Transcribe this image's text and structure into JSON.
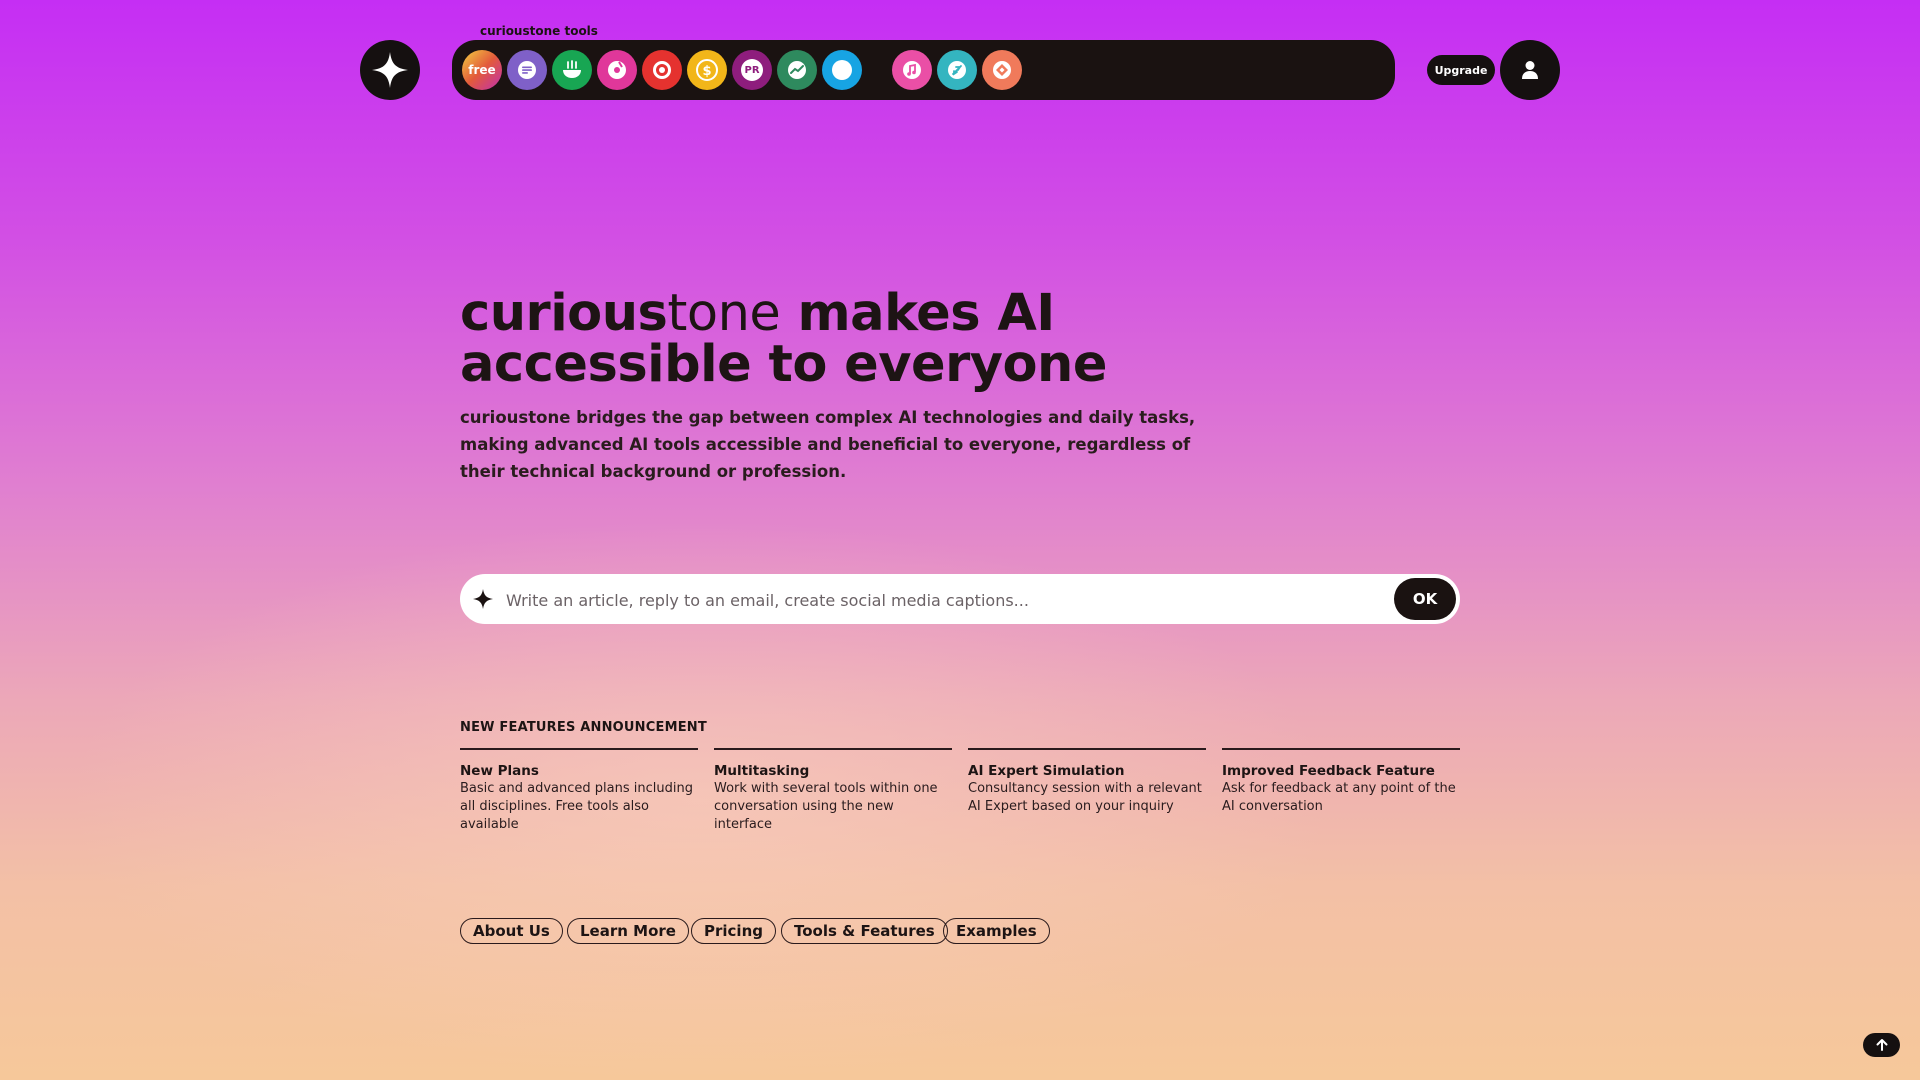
{
  "header": {
    "tools_label": "curioustone tools",
    "free_badge": "free",
    "pr_badge": "PR",
    "upgrade_label": "Upgrade",
    "tools": [
      {
        "name": "free-tool",
        "color": "#e8a33a"
      },
      {
        "name": "text-tool",
        "color": "#7f60c8"
      },
      {
        "name": "food-tool",
        "color": "#18a653"
      },
      {
        "name": "music-tool",
        "color": "#e0379a"
      },
      {
        "name": "target-tool",
        "color": "#e5322f"
      },
      {
        "name": "money-tool",
        "color": "#f2b619"
      },
      {
        "name": "pr-tool",
        "color": "#8e1d7d"
      },
      {
        "name": "chart-tool",
        "color": "#2e8a5e"
      },
      {
        "name": "circle-tool",
        "color": "#17a4e3"
      },
      {
        "name": "note-tool",
        "color": "#ea4fa6"
      },
      {
        "name": "travel-tool",
        "color": "#34b5c0"
      },
      {
        "name": "diamond-tool",
        "color": "#f07a5b"
      }
    ]
  },
  "hero": {
    "brand_bold": "curious",
    "brand_light": "tone",
    "headline_rest": " makes AI accessible to everyone",
    "description": "curioustone bridges the gap between complex AI technologies and daily tasks, making advanced AI tools accessible and beneficial to everyone, regardless of their technical background or profession."
  },
  "prompt": {
    "placeholder": "Write an article, reply to an email, create social media captions...",
    "ok_label": "OK"
  },
  "features": {
    "title": "NEW FEATURES ANNOUNCEMENT",
    "items": [
      {
        "title": "New Plans",
        "desc": "Basic and advanced plans including all disciplines. Free tools also available"
      },
      {
        "title": "Multitasking",
        "desc": "Work with several tools within one conversation using the new interface"
      },
      {
        "title": "AI Expert Simulation",
        "desc": "Consultancy session with a relevant AI Expert based on your inquiry"
      },
      {
        "title": "Improved Feedback Feature",
        "desc": "Ask for feedback at any point of the AI conversation"
      }
    ]
  },
  "links": [
    "About Us",
    "Learn More",
    "Pricing",
    "Tools & Features",
    "Examples"
  ]
}
